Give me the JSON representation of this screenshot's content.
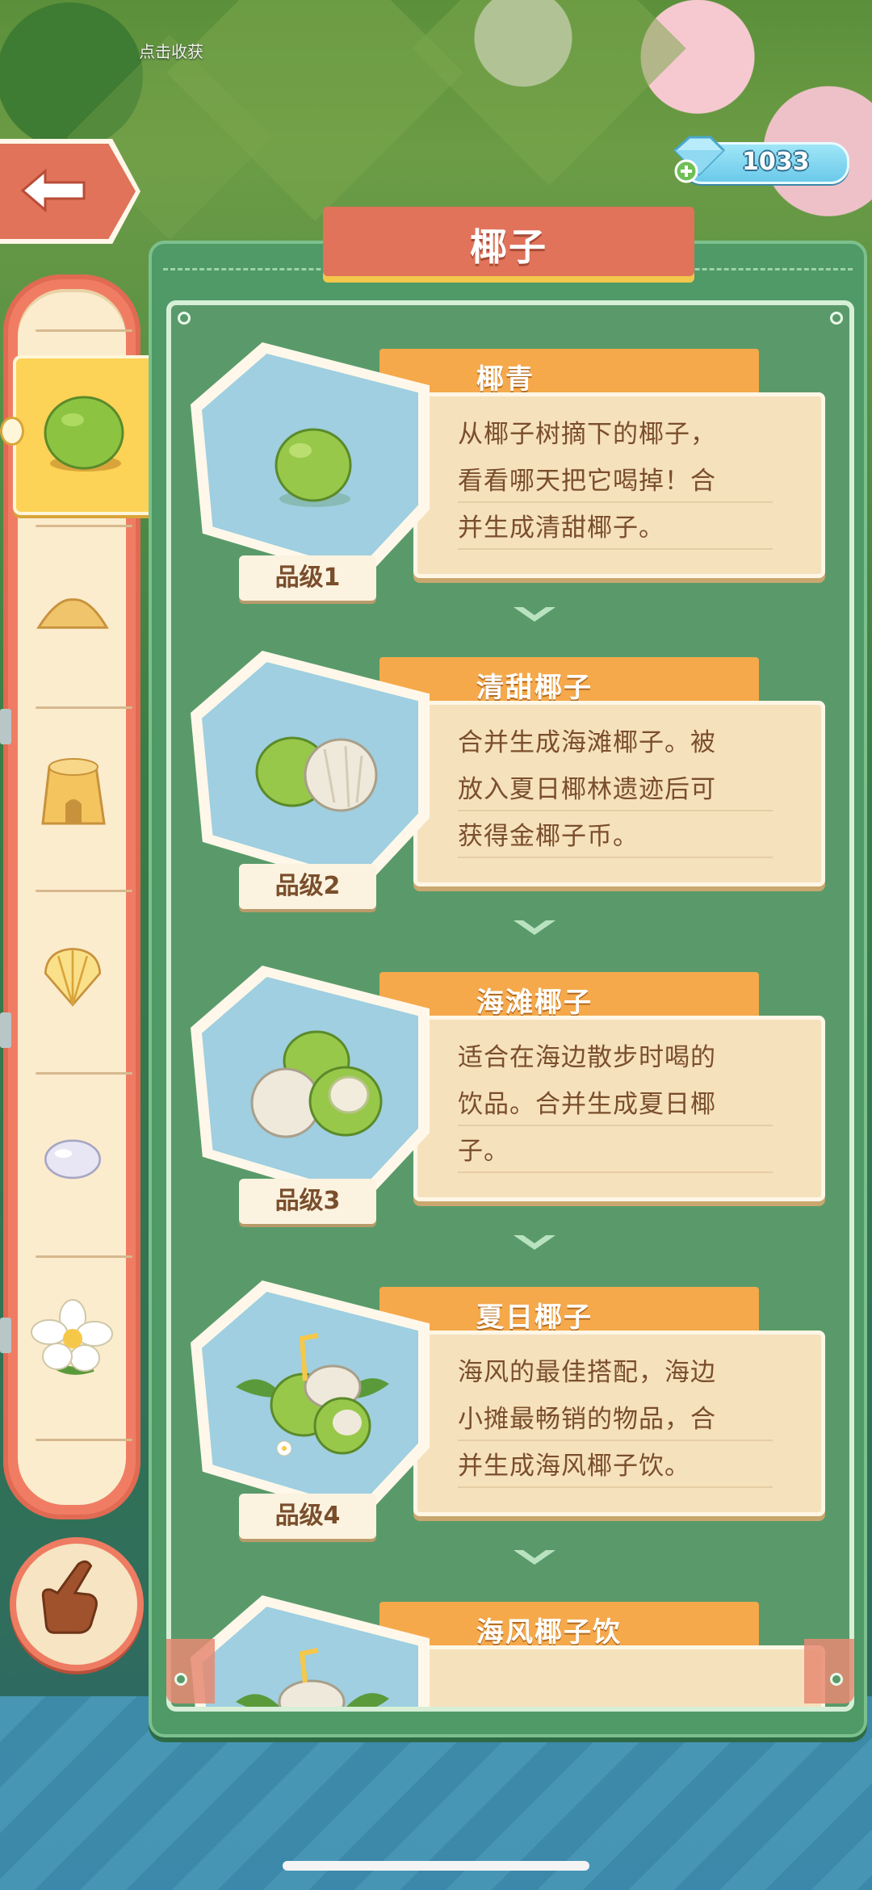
{
  "hud": {
    "hint_text": "点击收获",
    "gem_count": "1033",
    "gem_icon": "diamond-plus-icon",
    "back_icon": "left-arrow-icon"
  },
  "panel": {
    "title": "椰子"
  },
  "sidebar": {
    "items": [
      {
        "icon": "green-coconut-icon",
        "selected": true
      },
      {
        "icon": "sand-pile-icon"
      },
      {
        "icon": "sandcastle-icon"
      },
      {
        "icon": "seashell-icon"
      },
      {
        "icon": "pearl-icon"
      },
      {
        "icon": "plumeria-flower-icon"
      }
    ],
    "hand_icon": "pointing-hand-icon"
  },
  "entries": [
    {
      "name": "椰青",
      "grade": "品级1",
      "icon": "green-coconut-icon",
      "desc_lines": [
        "从椰子树摘下的椰子，",
        "看看哪天把它喝掉！合",
        "并生成清甜椰子。"
      ]
    },
    {
      "name": "清甜椰子",
      "grade": "品级2",
      "icon": "two-coconuts-icon",
      "desc_lines": [
        "合并生成海滩椰子。被",
        "放入夏日椰林遗迹后可",
        "获得金椰子币。"
      ]
    },
    {
      "name": "海滩椰子",
      "grade": "品级3",
      "icon": "three-coconuts-icon",
      "desc_lines": [
        "适合在海边散步时喝的",
        "饮品。合并生成夏日椰",
        "子。"
      ]
    },
    {
      "name": "夏日椰子",
      "grade": "品级4",
      "icon": "coconut-drink-straw-icon",
      "desc_lines": [
        "海风的最佳搭配，海边",
        "小摊最畅销的物品，合",
        "并生成海风椰子饮。"
      ]
    },
    {
      "name": "海风椰子饮",
      "grade": "",
      "icon": "coconut-drink-leaves-icon",
      "desc_lines": []
    }
  ],
  "colors": {
    "panel_green": "#4f9a66",
    "title_banner": "#e0735a",
    "name_tab": "#f5a94b",
    "desc_card": "#f6e1bd",
    "desc_text": "#7a4e2c",
    "selected_slot": "#fcd356"
  }
}
